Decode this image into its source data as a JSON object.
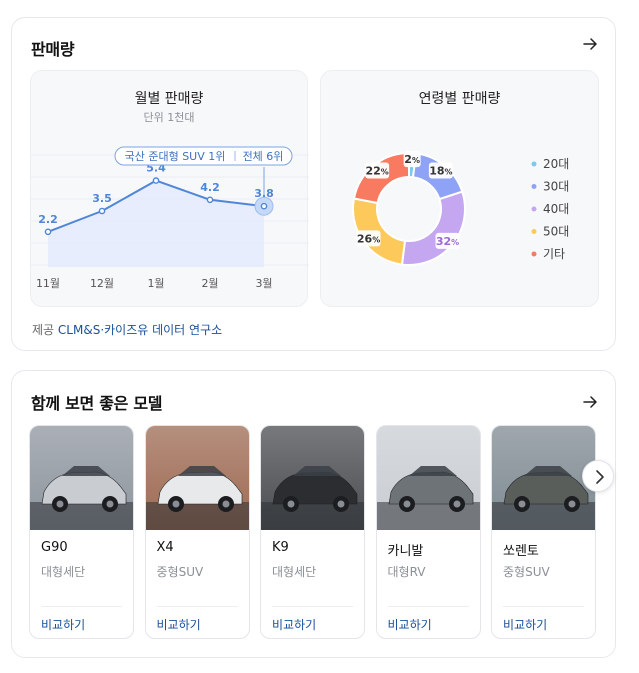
{
  "sales": {
    "title": "판매량",
    "source_prefix": "제공",
    "source_name": "CLM&S·카이즈유 데이터 연구소",
    "monthly": {
      "title": "월별 판매량",
      "unit": "단위 1천대",
      "badge_left": "국산 준대형 SUV 1위",
      "badge_right": "전체 6위"
    },
    "age": {
      "title": "연령별 판매량"
    }
  },
  "models_section": {
    "title": "함께 보면 좋은 모델",
    "compare_label": "비교하기",
    "items": [
      {
        "name": "G90",
        "type": "대형세단",
        "color": "#c9ccd1",
        "bg": "#8e959e"
      },
      {
        "name": "X4",
        "type": "중형SUV",
        "color": "#e8e9ea",
        "bg": "#9d6a52"
      },
      {
        "name": "K9",
        "type": "대형세단",
        "color": "#2b2d31",
        "bg": "#4a4c50"
      },
      {
        "name": "카니발",
        "type": "대형RV",
        "color": "#6e7378",
        "bg": "#c9cdd2"
      },
      {
        "name": "쏘렌토",
        "type": "중형SUV",
        "color": "#5a5e5a",
        "bg": "#7f8a92"
      }
    ]
  },
  "chart_data": [
    {
      "type": "line",
      "title": "월별 판매량",
      "subtitle": "단위 1천대",
      "categories": [
        "11월",
        "12월",
        "1월",
        "2월",
        "3월"
      ],
      "values": [
        2.2,
        3.5,
        5.4,
        4.2,
        3.8
      ],
      "value_labels": [
        "2.2",
        "3.5",
        "5.4",
        "4.2",
        "3.8"
      ],
      "ylim": [
        0,
        7
      ],
      "highlight_index": 4,
      "color": "#4f86d9"
    },
    {
      "type": "pie",
      "title": "연령별 판매량",
      "donut": true,
      "slices": [
        {
          "label": "20대",
          "value": 2,
          "value_label": "2",
          "unit": "%",
          "color": "#7ec8ef"
        },
        {
          "label": "30대",
          "value": 18,
          "value_label": "18",
          "unit": "%",
          "color": "#8ea3f5"
        },
        {
          "label": "40대",
          "value": 32,
          "value_label": "32",
          "unit": "%",
          "color": "#c5a7f1"
        },
        {
          "label": "50대",
          "value": 26,
          "value_label": "26",
          "unit": "%",
          "color": "#fdc95a"
        },
        {
          "label": "기타",
          "value": 22,
          "value_label": "22",
          "unit": "%",
          "color": "#f87a61"
        }
      ],
      "highlight_label": "40대",
      "legend": "right"
    }
  ]
}
